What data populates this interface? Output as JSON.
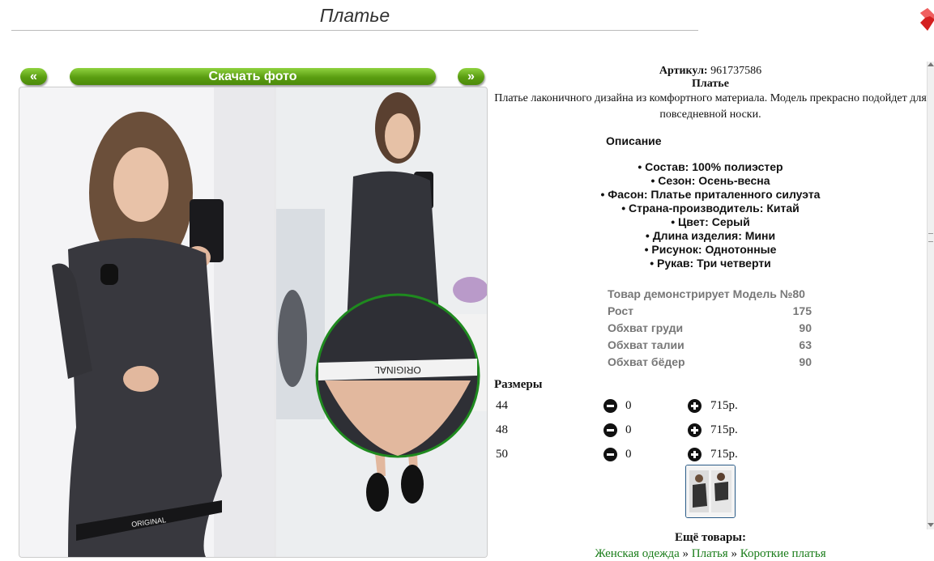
{
  "page": {
    "title": "Платье"
  },
  "nav": {
    "prev_label": "«",
    "download_label": "Скачать фото",
    "next_label": "»"
  },
  "product": {
    "article_label": "Артикул:",
    "article_value": "961737586",
    "name": "Платье",
    "summary": "Платье лаконичного дизайна из комфортного материала. Модель прекрасно подойдет для повседневной носки.",
    "description_heading": "Описание",
    "properties": [
      "• Состав: 100% полиэстер",
      "• Сезон: Осень-весна",
      "• Фасон: Платье приталенного силуэта",
      "• Страна-производитель: Китай",
      "• Цвет: Серый",
      "• Длина изделия: Мини",
      "• Рисунок: Однотонные",
      "• Рукав: Три четверти"
    ],
    "model": {
      "heading": "Товар демонстрирует Модель №80",
      "rows": [
        {
          "label": "Рост",
          "value": "175"
        },
        {
          "label": "Обхват груди",
          "value": "90"
        },
        {
          "label": "Обхват талии",
          "value": "63"
        },
        {
          "label": "Обхват бёдер",
          "value": "90"
        }
      ]
    }
  },
  "sizes": {
    "heading": "Размеры",
    "rows": [
      {
        "size": "44",
        "qty": "0",
        "price": "715р."
      },
      {
        "size": "48",
        "qty": "0",
        "price": "715р."
      },
      {
        "size": "50",
        "qty": "0",
        "price": "715р."
      }
    ]
  },
  "more": {
    "heading": "Ещё товары:",
    "breadcrumbs": [
      "Женская одежда",
      "Платья",
      "Короткие платья"
    ],
    "separator": "»"
  },
  "photo": {
    "print_text": "ORIGINAL"
  },
  "colors": {
    "accent_green": "#5a9d11",
    "link_green": "#1a7d1a",
    "close_red": "#d42020",
    "zoom_ring": "#1f8a1f"
  },
  "icons": {
    "close": "close-icon",
    "minus": "minus-circle-icon",
    "plus": "plus-circle-icon"
  }
}
